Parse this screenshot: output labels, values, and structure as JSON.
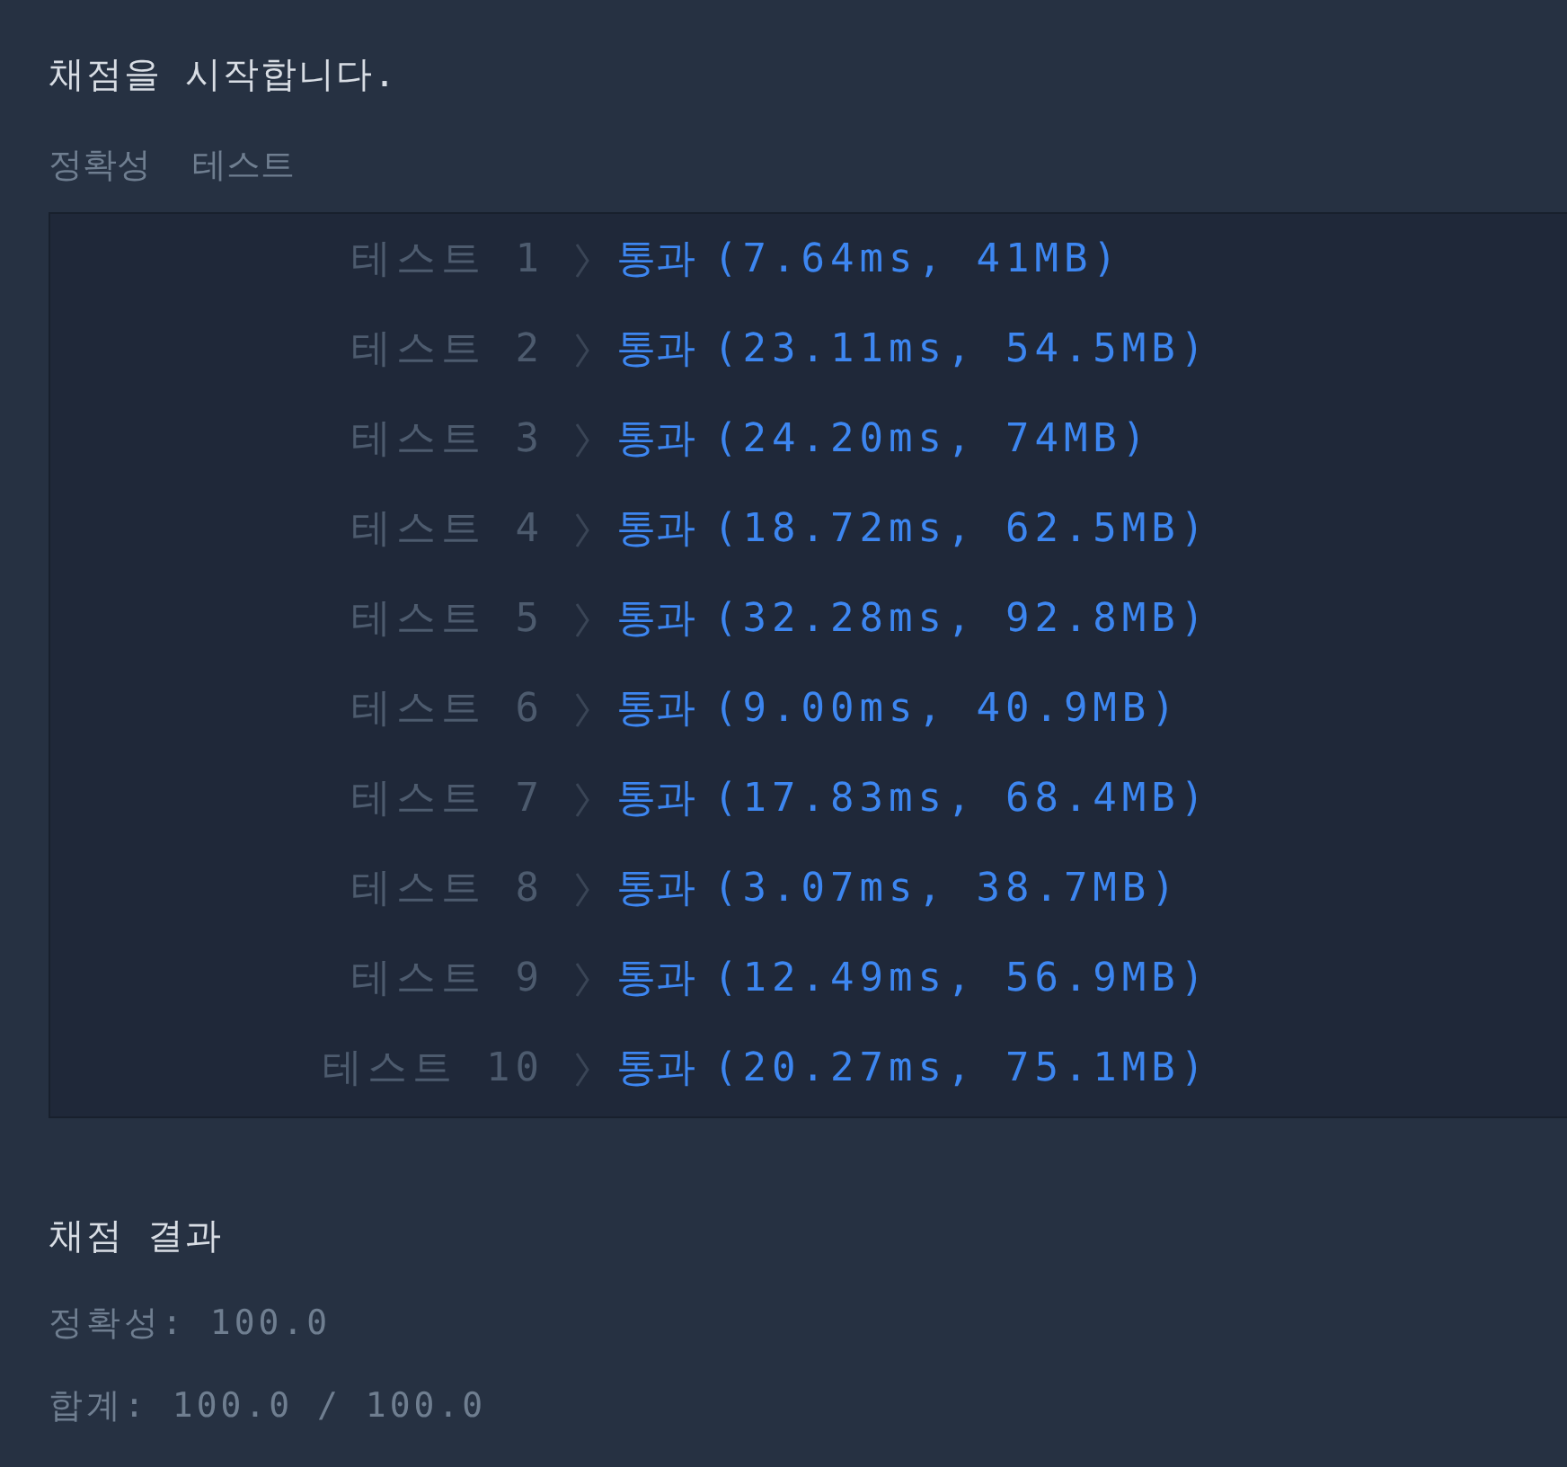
{
  "title": "채점을 시작합니다.",
  "section_label": "정확성  테스트",
  "tests": [
    {
      "label": "테스트 1",
      "status": "통과",
      "kind": "pass",
      "detail": "(7.64ms, 41MB)"
    },
    {
      "label": "테스트 2",
      "status": "통과",
      "kind": "pass",
      "detail": "(23.11ms, 54.5MB)"
    },
    {
      "label": "테스트 3",
      "status": "통과",
      "kind": "pass",
      "detail": "(24.20ms, 74MB)"
    },
    {
      "label": "테스트 4",
      "status": "통과",
      "kind": "pass",
      "detail": "(18.72ms, 62.5MB)"
    },
    {
      "label": "테스트 5",
      "status": "통과",
      "kind": "pass",
      "detail": "(32.28ms, 92.8MB)"
    },
    {
      "label": "테스트 6",
      "status": "통과",
      "kind": "pass",
      "detail": "(9.00ms, 40.9MB)"
    },
    {
      "label": "테스트 7",
      "status": "통과",
      "kind": "pass",
      "detail": "(17.83ms, 68.4MB)"
    },
    {
      "label": "테스트 8",
      "status": "통과",
      "kind": "pass",
      "detail": "(3.07ms, 38.7MB)"
    },
    {
      "label": "테스트 9",
      "status": "통과",
      "kind": "pass",
      "detail": "(12.49ms, 56.9MB)"
    },
    {
      "label": "테스트 10",
      "status": "통과",
      "kind": "pass",
      "detail": "(20.27ms, 75.1MB)"
    }
  ],
  "result": {
    "heading": "채점 결과",
    "lines": [
      "정확성: 100.0",
      "합계: 100.0 / 100.0"
    ]
  }
}
